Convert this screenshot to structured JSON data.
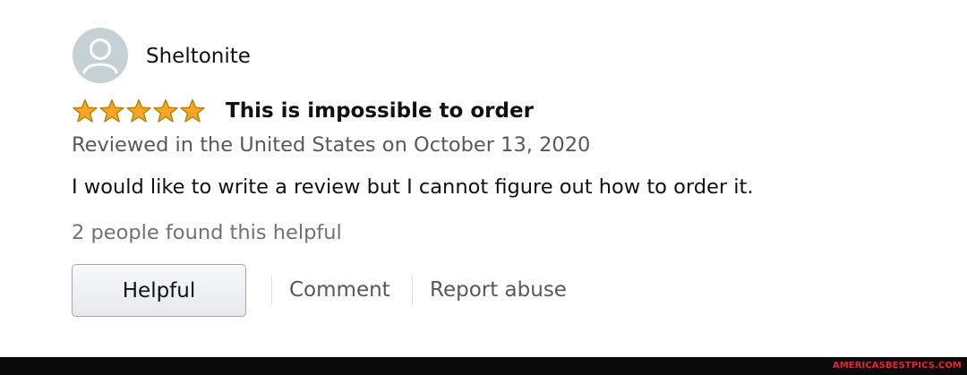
{
  "review": {
    "author": "Sheltonite",
    "rating": 5,
    "rating_max": 5,
    "title": "This is impossible to order",
    "meta": "Reviewed in the United States on October 13, 2020",
    "body": "I would like to write a review but I cannot figure out how to order it.",
    "helpful_count_text": "2 people found this helpful"
  },
  "actions": {
    "helpful_label": "Helpful",
    "comment_label": "Comment",
    "report_label": "Report abuse"
  },
  "icons": {
    "avatar": "user-avatar-icon",
    "star": "star-icon"
  },
  "colors": {
    "star_fill": "#f5a623",
    "star_stroke": "#b47a00",
    "avatar_bg": "#c6d1d6",
    "muted_text": "#565959",
    "watermark": "#e5262a"
  },
  "footer": {
    "watermark": "AMERICASBESTPICS.COM"
  }
}
